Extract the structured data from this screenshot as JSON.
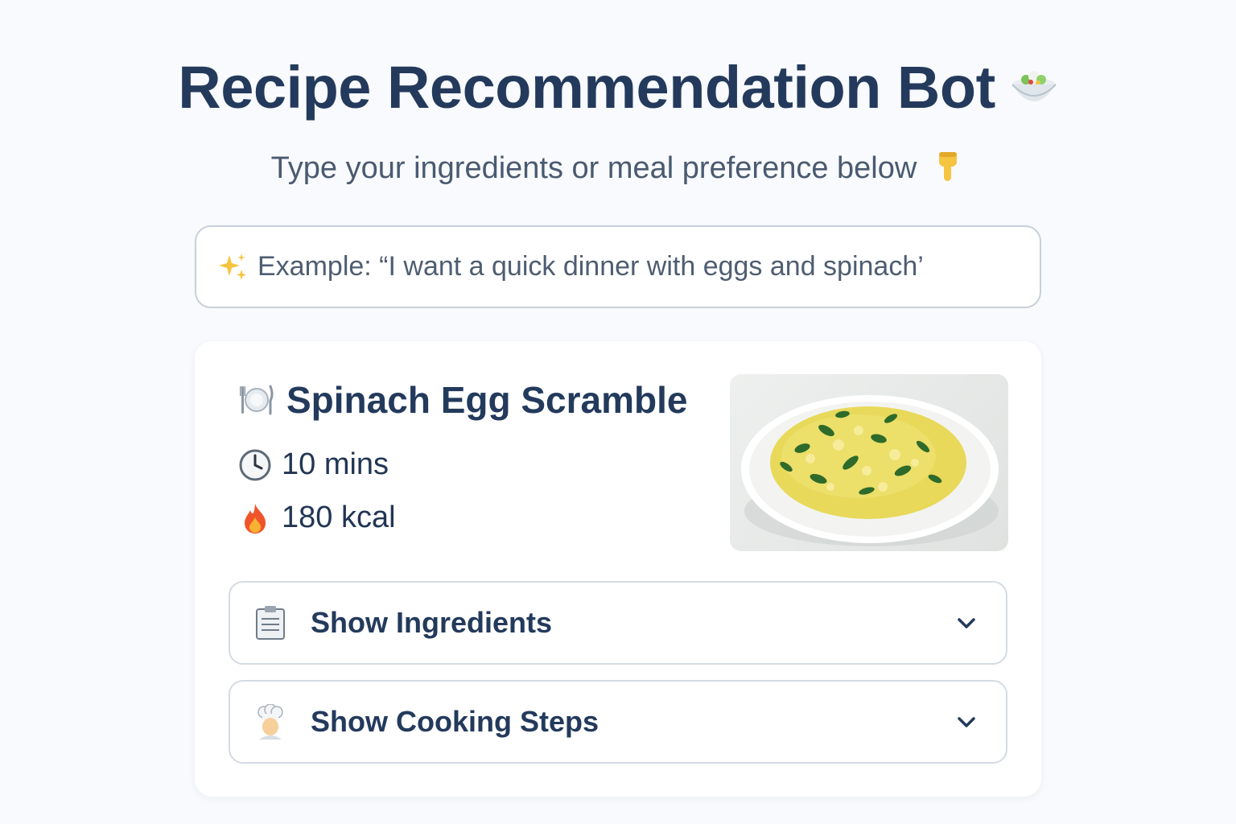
{
  "header": {
    "title": "Recipe Recommendation Bot",
    "title_icon": "salad-bowl-icon",
    "subtitle": "Type your ingredients or meal preference below",
    "subtitle_icon": "pointing-down-icon"
  },
  "search": {
    "icon": "sparkles-icon",
    "placeholder": "Example: “I want a quick dinner with eggs and spinach’"
  },
  "recipe": {
    "title_icon": "plate-cutlery-icon",
    "title": "Spinach Egg Scramble",
    "time_icon": "clock-icon",
    "time": "10 mins",
    "calories_icon": "fire-icon",
    "calories": "180 kcal",
    "image": "spinach-egg-scramble-photo",
    "sections": [
      {
        "icon": "clipboard-icon",
        "label": "Show Ingredients"
      },
      {
        "icon": "chef-icon",
        "label": "Show Cooking Steps"
      }
    ]
  },
  "colors": {
    "background": "#f8fafd",
    "heading": "#243a5c",
    "subtle_text": "#4a5a70",
    "border": "#d5dbe3"
  }
}
